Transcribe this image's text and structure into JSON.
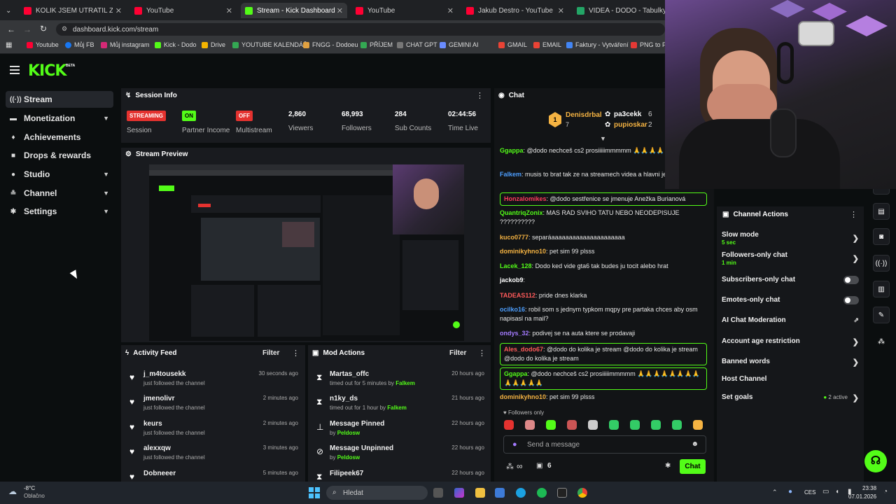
{
  "browser": {
    "tabs": [
      {
        "label": "KOLIK JSEM UTRATIL ZA VBUCK",
        "color": "#ff0033",
        "active": false
      },
      {
        "label": "YouTube",
        "color": "#ff0033",
        "active": false
      },
      {
        "label": "Stream - Kick Dashboard",
        "color": "#53fc18",
        "active": true
      },
      {
        "label": "YouTube",
        "color": "#ff0033",
        "active": false
      },
      {
        "label": "Jakub Destro - YouTube",
        "color": "#ff0033",
        "active": false
      },
      {
        "label": "VIDEA - DODO - Tabulky Goog",
        "color": "#23a566",
        "active": false
      }
    ],
    "url": "dashboard.kick.com/stream",
    "bookmarks": [
      "Youtube",
      "Můj FB",
      "Můj instagram",
      "Kick - Dodo",
      "Drive",
      "YOUTUBE KALENDÁŘ",
      "FNGG - Dodoeu",
      "PŘÍJEM",
      "CHAT GPT",
      "GEMINI AI",
      "GMAIL",
      "EMAIL",
      "Faktury - Vytváření",
      "PNG to PD"
    ]
  },
  "header": {
    "logo": "KICK",
    "beta": "BETA"
  },
  "sidebar": {
    "items": [
      {
        "label": "Stream",
        "icon": "broadcast-icon",
        "chevron": false
      },
      {
        "label": "Monetization",
        "icon": "dollar-icon",
        "chevron": true
      },
      {
        "label": "Achievements",
        "icon": "trophy-icon",
        "chevron": false
      },
      {
        "label": "Drops & rewards",
        "icon": "gift-icon",
        "chevron": false
      },
      {
        "label": "Studio",
        "icon": "camera-icon",
        "chevron": true
      },
      {
        "label": "Channel",
        "icon": "users-icon",
        "chevron": true
      },
      {
        "label": "Settings",
        "icon": "gear-icon",
        "chevron": true
      }
    ]
  },
  "session": {
    "title": "Session Info",
    "session": {
      "badge": "STREAMING",
      "label": "Session"
    },
    "partner": {
      "badge": "ON",
      "label": "Partner Income"
    },
    "multistream": {
      "badge": "OFF",
      "label": "Multistream"
    },
    "viewers": {
      "value": "2,860",
      "label": "Viewers"
    },
    "followers": {
      "value": "68,993",
      "label": "Followers"
    },
    "subs": {
      "value": "284",
      "label": "Sub Counts"
    },
    "time": {
      "value": "02:44:56",
      "label": "Time Live"
    }
  },
  "preview": {
    "title": "Stream Preview"
  },
  "activity": {
    "title": "Activity Feed",
    "filter": "Filter",
    "rows": [
      {
        "name": "j_m4tousekk",
        "sub": "just followed the channel",
        "time": "30 seconds ago"
      },
      {
        "name": "jmenolivr",
        "sub": "just followed the channel",
        "time": "2 minutes ago"
      },
      {
        "name": "keurs",
        "sub": "just followed the channel",
        "time": "2 minutes ago"
      },
      {
        "name": "alexxqw",
        "sub": "just followed the channel",
        "time": "3 minutes ago"
      },
      {
        "name": "Dobneeer",
        "sub": "",
        "time": "5 minutes ago"
      }
    ]
  },
  "mod": {
    "title": "Mod Actions",
    "filter": "Filter",
    "rows": [
      {
        "name": "Martas_offc",
        "sub": "timed out for 5 minutes by",
        "by": "Falkem",
        "time": "20 hours ago",
        "icon": "hourglass-icon"
      },
      {
        "name": "n1ky_ds",
        "sub": "timed out for 1 hour by",
        "by": "Falkem",
        "time": "21 hours ago",
        "icon": "hourglass-icon"
      },
      {
        "name": "Message Pinned",
        "sub": "by",
        "by": "Peldosw",
        "time": "22 hours ago",
        "icon": "pin-icon"
      },
      {
        "name": "Message Unpinned",
        "sub": "by",
        "by": "Peldosw",
        "time": "22 hours ago",
        "icon": "unpin-icon"
      },
      {
        "name": "Filipeek67",
        "sub": "",
        "by": "",
        "time": "22 hours ago",
        "icon": "hourglass-icon"
      }
    ]
  },
  "chat": {
    "title": "Chat",
    "top": [
      {
        "name": "Denisdrbal",
        "count": "7",
        "rank": "1"
      },
      {
        "name": "pa3cekk",
        "count": "6"
      },
      {
        "name": "pupioskar",
        "count": "2"
      }
    ],
    "messages": [
      {
        "user": "Ggappa",
        "color": "#53fc18",
        "text": "@dodo nechceš cs2 prosiiiiimmmmm 🙏🙏🙏🙏🙏🙏🙏",
        "hl": false
      },
      {
        "user": "Falkem",
        "color": "#4d9fff",
        "text": "musis to brat tak ze na streamech videa a hlavni je ze te to bavi",
        "hl": false
      },
      {
        "user": "Honzalomikes",
        "color": "#ff3b5c",
        "text": "@dodo sestřenice se jmenuje Anežka Burianová",
        "hl": true
      },
      {
        "user": "QuantriqZonix",
        "color": "#53fc18",
        "text": "MAS RAD SVIHO TATU NEBO NEODEPISUJE ??????????",
        "hl": false
      },
      {
        "user": "kuco0777",
        "color": "#f5b342",
        "text": "separáaaaaaaaaaaaaaaaaaaaaa",
        "hl": false
      },
      {
        "user": "dominikyhno10",
        "color": "#f5b342",
        "text": "pet sim 99 plsss",
        "hl": false
      },
      {
        "user": "Lacek_128",
        "color": "#53fc18",
        "text": "Dodo ked vide gta6 tak budes ju tocit alebo hrat",
        "hl": false
      },
      {
        "user": "jackob9",
        "color": "#ffffff",
        "text": "",
        "hl": false
      },
      {
        "user": "TADEAS112",
        "color": "#ff5a5a",
        "text": "pride dnes klarka",
        "hl": false
      },
      {
        "user": "ocilko16",
        "color": "#4d9fff",
        "text": "robil som s jednym typkom mqpy pre partaka chces aby osm napisasl na mail?",
        "hl": false
      },
      {
        "user": "ondys_32",
        "color": "#a47bff",
        "text": "podivej se na auta ktere se prodavaji",
        "hl": false
      },
      {
        "user": "Ales_dodo67",
        "color": "#ff5a5a",
        "text": "@dodo do kolika je stream @dodo do kolika je stream @dodo do kolika je stream",
        "hl": true
      },
      {
        "user": "Ggappa",
        "color": "#53fc18",
        "text": "@dodo nechceš cs2 prosiiiiimmmmm 🙏🙏🙏🙏🙏🙏🙏🙏🙏🙏🙏🙏🙏",
        "hl": true
      },
      {
        "user": "dominikyhno10",
        "color": "#f5b342",
        "text": "pet sim 99 plsss",
        "hl": false
      }
    ],
    "followers_only": "Followers only",
    "placeholder": "Send a message",
    "infinity": "∞",
    "count": "6",
    "send": "Chat"
  },
  "channel_actions": {
    "title": "Channel Actions",
    "items": [
      {
        "label": "Slow mode",
        "sub": "5 sec",
        "kind": "chev"
      },
      {
        "label": "Followers-only chat",
        "sub": "1 min",
        "kind": "chev"
      },
      {
        "label": "Subscribers-only chat",
        "sub": "",
        "kind": "toggle"
      },
      {
        "label": "Emotes-only chat",
        "sub": "",
        "kind": "toggle"
      },
      {
        "label": "AI Chat Moderation",
        "sub": "",
        "kind": "ext"
      },
      {
        "label": "Account age restriction",
        "sub": "",
        "kind": "chev"
      },
      {
        "label": "Banned words",
        "sub": "",
        "kind": "chev"
      },
      {
        "label": "Host Channel",
        "sub": "",
        "kind": "none"
      },
      {
        "label": "Set goals",
        "sub": "",
        "kind": "chev",
        "extra": "2 active"
      }
    ]
  },
  "taskbar": {
    "temp": "-8°C",
    "weather": "Oblačno",
    "search": "Hledat",
    "lang": "CES",
    "time": "23:38",
    "date": "07.01.2026"
  },
  "colors": {
    "accent": "#53fc18",
    "streaming": "#e4322f",
    "panel": "#191b1f"
  }
}
